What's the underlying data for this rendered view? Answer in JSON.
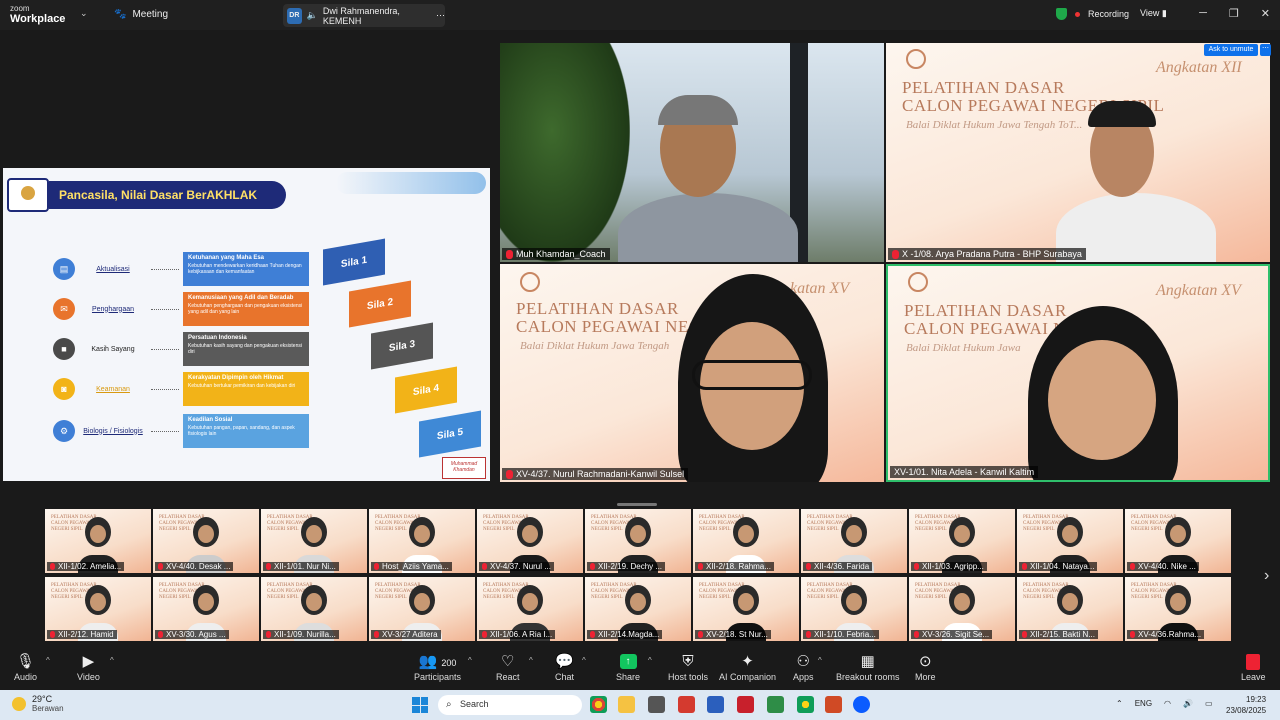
{
  "app": {
    "logo_line1": "zoom",
    "logo_line2": "Workplace",
    "meeting_label": "Meeting",
    "presenter_initials": "DR",
    "presenter_name": "Dwi Rahmanendra, KEMENH",
    "recording_label": "Recording",
    "view_label": "View",
    "ask_to_unmute": "Ask to unmute"
  },
  "shared_slide": {
    "title": "Pancasila, Nilai Dasar BerAKHLAK",
    "values": [
      {
        "label": "Aktualisasi",
        "box_title": "Ketuhanan yang Maha Esa",
        "box_text": "Kebutuhan mendewarkan keridhaan Tuhan dengan kebijkasaan dan kemanfaatan",
        "color": "#3f7fd6",
        "icon_color": "#3f7fd6"
      },
      {
        "label": "Penghargaan",
        "box_title": "Kemanusiaan yang Adil dan Beradab",
        "box_text": "Kebutuhan penghargaan dan pengakuan eksistensi yang adil dan yang lain",
        "color": "#e8742c",
        "icon_color": "#e8742c"
      },
      {
        "label": "Kasih Sayang",
        "box_title": "Persatuan Indonesia",
        "box_text": "Kebutuhan kasih sayang dan pengakuan eksistensi diri",
        "color": "#5a5a5a",
        "icon_color": "#4a4a4a"
      },
      {
        "label": "Keamanan",
        "box_title": "Kerakyatan Dipimpin oleh Hikmat",
        "box_text": "Kebutuhan bertukar pemikiran dan kebijakan diri",
        "color": "#f2b318",
        "icon_color": "#f2b318"
      },
      {
        "label": "Biologis / Fisiologis",
        "box_title": "Keadilan Sosial",
        "box_text": "Kebutuhan pangan, papan, sandang, dan aspek fisiologis lain",
        "color": "#5aa3e0",
        "icon_color": "#3f7fd6"
      }
    ],
    "steps": [
      "Sila 1",
      "Sila 2",
      "Sila 3",
      "Sila 4",
      "Sila 5"
    ],
    "step_colors": [
      "#2f5fb3",
      "#e8742c",
      "#555555",
      "#f2b318",
      "#3f89d6"
    ],
    "signature_line1": "Muhammad",
    "signature_line2": "Khamdan"
  },
  "tiles": [
    {
      "name": "Muh Khamdan_Coach"
    },
    {
      "name": "X -1/08. Arya Pradana Putra - BHP Surabaya",
      "bg_title": "PELATIHAN DASAR\nCALON PEGAWAI NEGERI SIPIL",
      "bg_sub": "Balai Diklat Hukum Jawa Tengah ToT...",
      "angkatan": "Angkatan XII"
    },
    {
      "name": "XV-4/37. Nurul Rachmadani-Kanwil Sulsel",
      "bg_title": "PELATIHAN DASAR\nCALON PEGAWAI NEG...",
      "bg_sub": "Balai Diklat Hukum Jawa Tengah",
      "angkatan": "katan XV"
    },
    {
      "name": "XV-1/01. Nita Adela - Kanwil Kaltim",
      "bg_title": "PELATIHAN DASAR\nCALON PEGAWAI N...",
      "bg_sub": "Balai Diklat Hukum Jawa",
      "angkatan": "Angkatan XV"
    }
  ],
  "gallery": [
    "XII-1/02. Amelia...",
    "XV-4/40. Desak ...",
    "XII-1/01. Nur Ni...",
    "Host_Aziis Yama...",
    "XV-4/37. Nurul ...",
    "XII-2/19. Dechy ...",
    "XII-2/18. Rahma...",
    "XII-4/36. Farida",
    "XII-1/03. Agripp...",
    "XII-1/04. Nataya...",
    "XV-4/40. Nike ...",
    "XII-2/12. Hamid",
    "XV-3/30. Agus ...",
    "XII-1/09. Nurilla...",
    "XV-3/27 Aditera",
    "XII-1/06. A Ria I...",
    "XII-2/14.Magda...",
    "XV-2/18. St Nur...",
    "XII-1/10. Febria...",
    "XV-3/26. Sigit Se...",
    "XII-2/15. Bakti N...",
    "XV-4/36.Rahma..."
  ],
  "toolbar": {
    "audio": "Audio",
    "video": "Video",
    "participants": "Participants",
    "participant_count": "200",
    "react": "React",
    "chat": "Chat",
    "share": "Share",
    "host_tools": "Host tools",
    "ai_companion": "AI Companion",
    "apps": "Apps",
    "breakout_rooms": "Breakout rooms",
    "more": "More",
    "leave": "Leave"
  },
  "taskbar": {
    "temperature": "29°C",
    "weather": "Berawan",
    "search_placeholder": "Search",
    "lang": "ENG",
    "time": "19:23",
    "date": "23/08/2025"
  }
}
